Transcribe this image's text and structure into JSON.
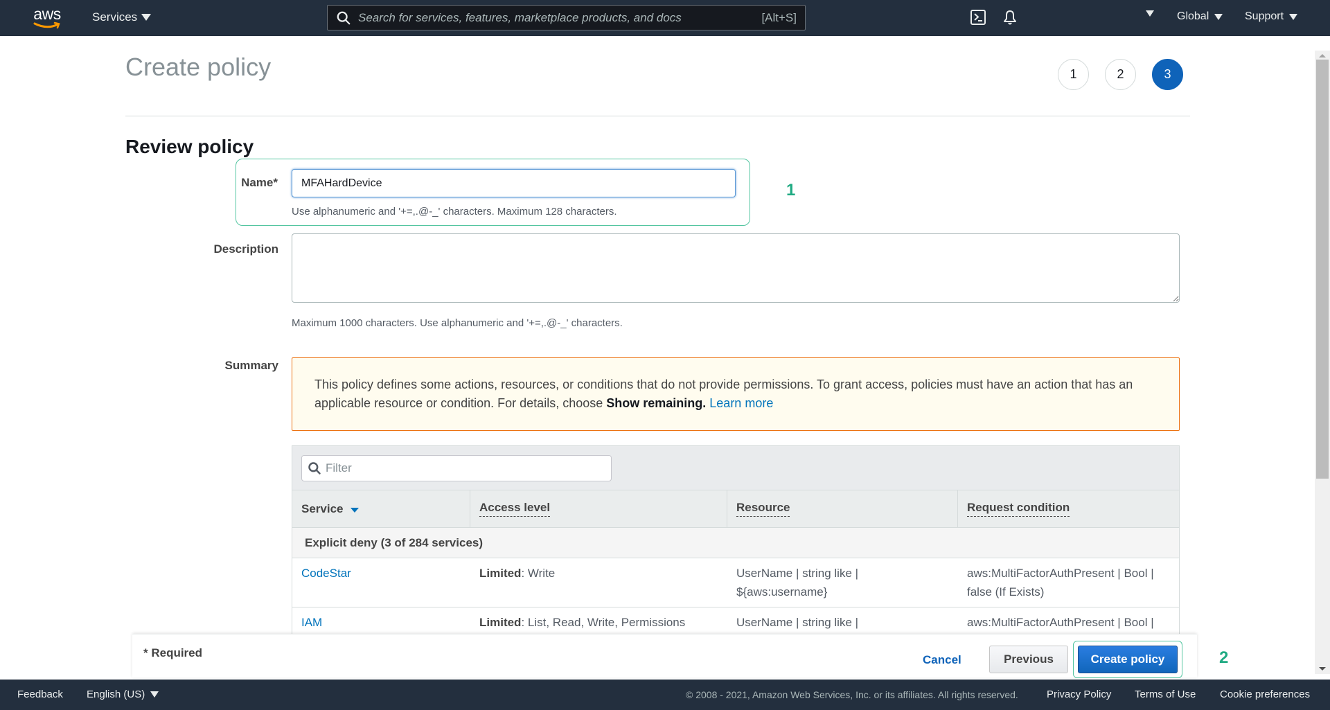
{
  "topnav": {
    "logo_text": "aws",
    "services_label": "Services",
    "search_placeholder": "Search for services, features, marketplace products, and docs",
    "search_shortcut": "[Alt+S]",
    "region_label": "Global",
    "support_label": "Support"
  },
  "page": {
    "title": "Create policy",
    "steps": [
      "1",
      "2",
      "3"
    ],
    "active_step": 3,
    "section_title": "Review policy"
  },
  "form": {
    "name_label": "Name*",
    "name_value": "MFAHardDevice",
    "name_hint": "Use alphanumeric and '+=,.@-_' characters. Maximum 128 characters.",
    "description_label": "Description",
    "description_value": "",
    "description_hint": "Maximum 1000 characters. Use alphanumeric and '+=,.@-_' characters.",
    "summary_label": "Summary"
  },
  "annotations": {
    "first": "1",
    "second": "2",
    "color": "#1faa82"
  },
  "alert": {
    "text": "This policy defines some actions, resources, or conditions that do not provide permissions. To grant access, policies must have an action that has an applicable resource or condition. For details, choose ",
    "bold": "Show remaining.",
    "link": "Learn more"
  },
  "summary_table": {
    "filter_placeholder": "Filter",
    "columns": [
      "Service",
      "Access level",
      "Resource",
      "Request condition"
    ],
    "group_label": "Explicit deny (3 of 284 services)",
    "rows": [
      {
        "service": "CodeStar",
        "access_bold": "Limited",
        "access_rest": ": Write",
        "resource_line1": "UserName | string like |",
        "resource_line2": "${aws:username}",
        "condition_line1": "aws:MultiFactorAuthPresent | Bool |",
        "condition_line2": "false (If Exists)"
      },
      {
        "service": "IAM",
        "access_bold": "Limited",
        "access_rest": ": List, Read, Write, Permissions",
        "resource_line1": "UserName | string like |",
        "resource_line2": "",
        "condition_line1": "aws:MultiFactorAuthPresent | Bool |",
        "condition_line2": ""
      }
    ]
  },
  "actions": {
    "required_note": "* Required",
    "cancel": "Cancel",
    "previous": "Previous",
    "create": "Create policy"
  },
  "footer": {
    "feedback": "Feedback",
    "language": "English (US)",
    "copyright": "© 2008 - 2021, Amazon Web Services, Inc. or its affiliates. All rights reserved.",
    "privacy": "Privacy Policy",
    "terms": "Terms of Use",
    "cookies": "Cookie preferences"
  },
  "colors": {
    "nav_bg": "#232f3e",
    "primary": "#0f63b9",
    "link": "#0073bb",
    "warning_border": "#ec7211",
    "highlight": "#53c5a0"
  }
}
